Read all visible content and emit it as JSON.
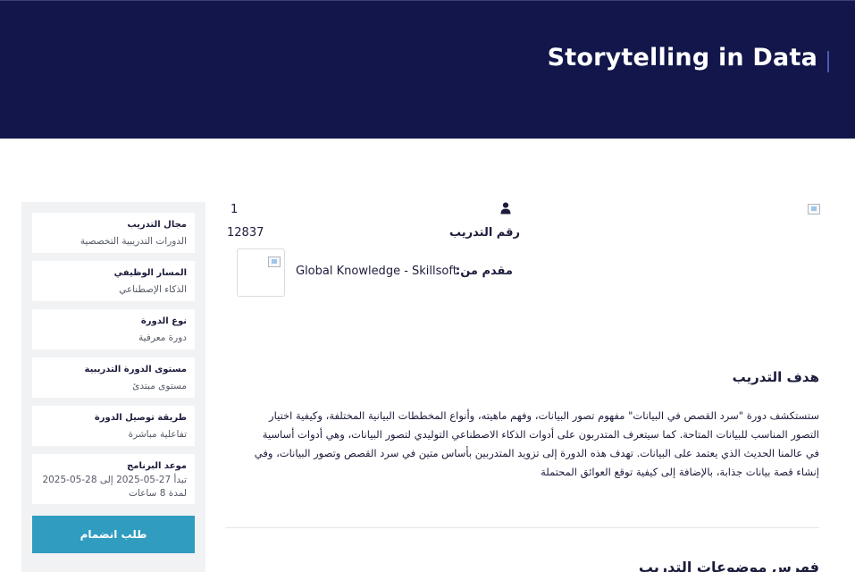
{
  "hero": {
    "title": "Storytelling in Data"
  },
  "sidebar": {
    "cards": [
      {
        "label": "مجال التدريب",
        "value": "الدورات التدريبية التخصصية"
      },
      {
        "label": "المسار الوظيفي",
        "value": "الذكاء الإصطناعي"
      },
      {
        "label": "نوع الدورة",
        "value": "دورة معرفية"
      },
      {
        "label": "مستوى الدورة التدريبية",
        "value": "مستوى مبتدئ"
      },
      {
        "label": "طريقة توصيل الدورة",
        "value": "تفاعلية مباشرة"
      }
    ],
    "schedule": {
      "label": "موعد البرنامج",
      "line1": "تبدأ 27-05-2025 إلى 28-05-2025",
      "line2": "لمدة 8 ساعات"
    },
    "join_label": "طلب انضمام"
  },
  "info": {
    "enrolled_count": "1",
    "code_label": "رقم التدريب",
    "code_value": "12837",
    "provider_label": "مقدم من:",
    "provider_name": "Global Knowledge - Skillsoft",
    "person_icon": "user-icon"
  },
  "goal": {
    "title": "هدف التدريب",
    "text": "ستستكشف دورة \"سرد القصص في البيانات\" مفهوم تصور البيانات، وفهم ماهيته، وأنواع المخططات البيانية المختلفة، وكيفية اختيار التصور المناسب للبيانات المتاحة. كما سيتعرف المتدربون على أدوات الذكاء الاصطناعي التوليدي لتصور البيانات، وهي أدوات أساسية في عالمنا الحديث الذي يعتمد على البيانات. تهدف هذه الدورة إلى تزويد المتدربين بأساس متين في سرد القصص وتصور البيانات، وفي إنشاء قصة بيانات جذابة، بالإضافة إلى كيفية توقع العوائق المحتملة"
  },
  "toc": {
    "title": "فهرس موضوعات التدريب"
  },
  "colors": {
    "hero_bg": "#12164a",
    "button_bg": "#2f9cc0",
    "sidebar_bg": "#f1f2f4"
  }
}
